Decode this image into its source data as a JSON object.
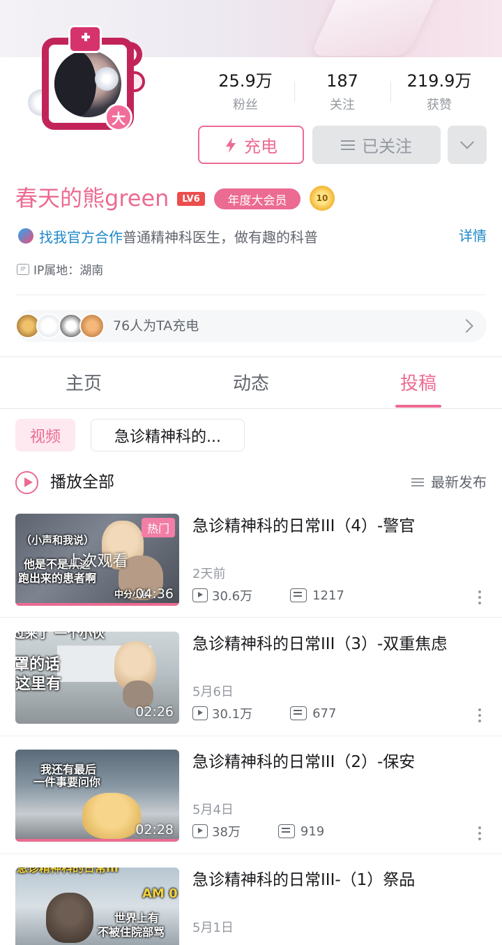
{
  "profile": {
    "avatar_badge": "大",
    "stats": [
      {
        "value": "25.9万",
        "label": "粉丝"
      },
      {
        "value": "187",
        "label": "关注"
      },
      {
        "value": "219.9万",
        "label": "获赞"
      }
    ],
    "charge_button": "充电",
    "follow_button": "已关注",
    "name": "春天的熊green",
    "level": "LV6",
    "vip_tag": "年度大会员",
    "medal": "10",
    "bio_link": "找我官方合作",
    "bio_text": "普通精神科医生，做有趣的科普",
    "detail_link": "详情",
    "ip": "IP属地：湖南",
    "ip_icon_text": "IP",
    "charge_count_text": "76人为TA充电"
  },
  "tabs": [
    {
      "label": "主页"
    },
    {
      "label": "动态"
    },
    {
      "label": "投稿"
    }
  ],
  "filters": {
    "active": "视频",
    "collection": "急诊精神科的..."
  },
  "list_header": {
    "play_all": "播放全部",
    "sort": "最新发布"
  },
  "videos": [
    {
      "title": "急诊精神科的日常III（4）-警官",
      "date": "2天前",
      "views": "30.6万",
      "danmaku": "1217",
      "duration": "04:36",
      "hot": "热门",
      "watched": "上次观看",
      "cap1": "（小声和我说）",
      "cap2": "他是不是从这",
      "cap3": "跑出来的患者啊",
      "cap4": "中分小伙"
    },
    {
      "title": "急诊精神科的日常III（3）-双重焦虑",
      "date": "5月6日",
      "views": "30.1万",
      "danmaku": "677",
      "duration": "02:26",
      "cap1": "过来了 一个小伙",
      "cap2": "罩的话",
      "cap3": "这里有"
    },
    {
      "title": "急诊精神科的日常III（2）-保安",
      "date": "5月4日",
      "views": "38万",
      "danmaku": "919",
      "duration": "02:28",
      "cap1": "我还有最后",
      "cap2": "一件事要问你"
    },
    {
      "title": "急诊精神科的日常III-（1）祭品",
      "date": "5月1日",
      "cap1": "急诊精神科的日常III",
      "cap2": "AM 0",
      "cap3": "世界上有",
      "cap4": "不被住院部骂"
    }
  ],
  "colors": {
    "accent": "#ec6b92",
    "link": "#1e88c8",
    "text_secondary": "#61666d",
    "text_muted": "#9499a0",
    "button_gray": "#e3e5e7"
  }
}
